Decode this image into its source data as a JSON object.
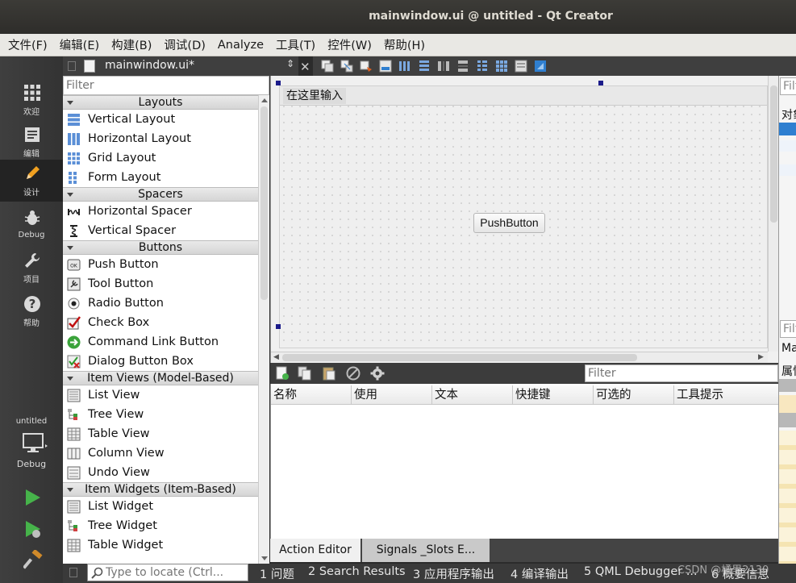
{
  "window": {
    "title": "mainwindow.ui @ untitled - Qt Creator"
  },
  "menu": [
    "文件(F)",
    "编辑(E)",
    "构建(B)",
    "调试(D)",
    "Analyze",
    "工具(T)",
    "控件(W)",
    "帮助(H)"
  ],
  "modes": [
    {
      "label": "欢迎",
      "icon": "grid-icon"
    },
    {
      "label": "编辑",
      "icon": "edit-icon"
    },
    {
      "label": "设计",
      "icon": "pencil-icon"
    },
    {
      "label": "Debug",
      "icon": "bug-icon"
    },
    {
      "label": "项目",
      "icon": "wrench-icon"
    },
    {
      "label": "帮助",
      "icon": "question-icon"
    }
  ],
  "kit": {
    "project": "untitled",
    "config": "Debug"
  },
  "document": {
    "name": "mainwindow.ui*"
  },
  "widgetbox": {
    "filter_placeholder": "Filter",
    "categories": [
      {
        "name": "Layouts",
        "items": [
          "Vertical Layout",
          "Horizontal Layout",
          "Grid Layout",
          "Form Layout"
        ]
      },
      {
        "name": "Spacers",
        "items": [
          "Horizontal Spacer",
          "Vertical Spacer"
        ]
      },
      {
        "name": "Buttons",
        "items": [
          "Push Button",
          "Tool Button",
          "Radio Button",
          "Check Box",
          "Command Link Button",
          "Dialog Button Box"
        ]
      },
      {
        "name": "Item Views (Model-Based)",
        "items": [
          "List View",
          "Tree View",
          "Table View",
          "Column View",
          "Undo View"
        ]
      },
      {
        "name": "Item Widgets (Item-Based)",
        "items": [
          "List Widget",
          "Tree Widget",
          "Table Widget"
        ]
      }
    ]
  },
  "form": {
    "menu_placeholder": "在这里输入",
    "push_button": "PushButton"
  },
  "action_editor": {
    "filter_placeholder": "Filter",
    "columns": [
      "名称",
      "使用",
      "文本",
      "快捷键",
      "可选的",
      "工具提示"
    ],
    "tabs": [
      "Action Editor",
      "Signals _Slots E..."
    ]
  },
  "right_panel": {
    "filter1": "Filt",
    "objects": "对象",
    "filter2": "Filt",
    "class": "Ma",
    "props": "属性"
  },
  "statusbar": {
    "locate_placeholder": "Type to locate (Ctrl...",
    "panes": [
      "1  问题",
      "2  Search Results",
      "3  应用程序输出",
      "4  编译输出",
      "5  QML Debugger ...",
      "6  概要信息"
    ]
  },
  "watermark": "CSDN @橘里2130",
  "colors": {
    "accent_blue": "#2f7fd0",
    "run_green": "#46b34a",
    "sidebar_bg": "#3a3a3a"
  }
}
